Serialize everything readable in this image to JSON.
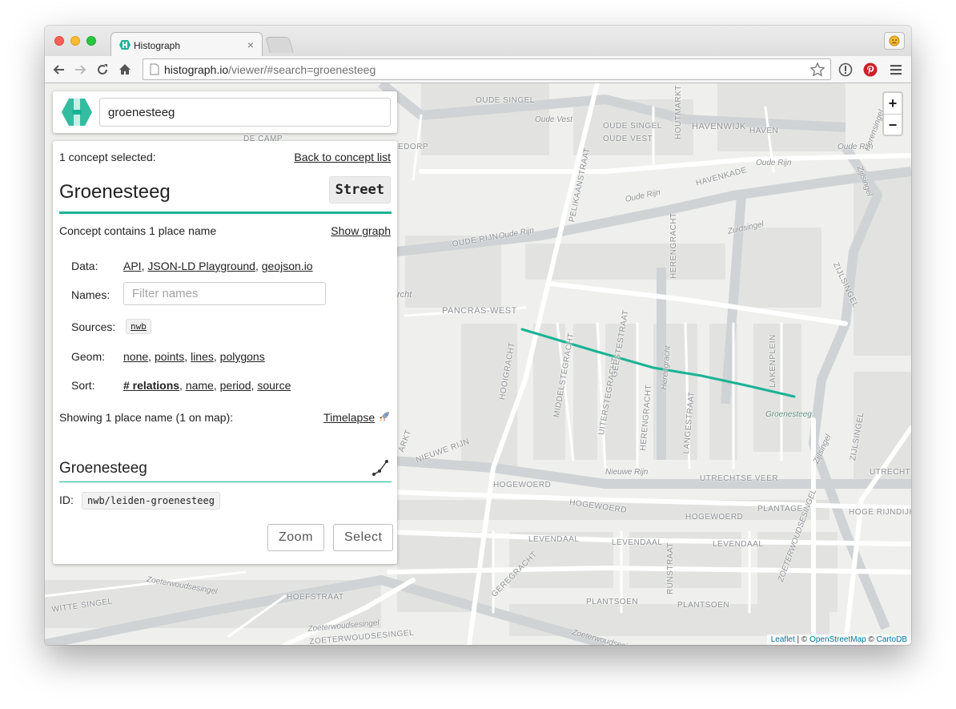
{
  "browser": {
    "tab_title": "Histograph",
    "tab_close": "×",
    "url_host": "histograph.io",
    "url_path": "/viewer/#search=groenesteeg"
  },
  "search": {
    "value": "groenesteeg"
  },
  "panel": {
    "selected_text": "1 concept selected:",
    "back_link": "Back to concept list",
    "concept_name": "Groenesteeg",
    "concept_type": "Street",
    "contains_text": "Concept contains 1 place name",
    "show_graph": "Show graph",
    "data_label": "Data:",
    "data_links": [
      "API",
      "JSON-LD Playground",
      "geojson.io"
    ],
    "names_label": "Names:",
    "names_placeholder": "Filter names",
    "sources_label": "Sources:",
    "sources_value": "nwb",
    "geom_label": "Geom:",
    "geom_links": [
      "none",
      "points",
      "lines",
      "polygons"
    ],
    "sort_label": "Sort:",
    "sort_links": [
      "# relations",
      "name",
      "period",
      "source"
    ],
    "showing_text": "Showing 1 place name (1 on map):",
    "timelapse": "Timelapse",
    "place": {
      "name": "Groenesteeg",
      "id_label": "ID:",
      "id_value": "nwb/leiden-groenesteeg"
    },
    "zoom_button": "Zoom",
    "select_button": "Select"
  },
  "map": {
    "zoom_in": "+",
    "zoom_out": "−",
    "highlight_color": "#1ab394",
    "labels": {
      "oude_singel_1": "OUDE SINGEL",
      "oude_vest": "Oude Vest",
      "oude_singel_2": "OUDE SINGEL",
      "oude_vest_2": "OUDE VEST",
      "havenwijk": "HAVENWIJK",
      "haven": "HAVEN",
      "de_camp": "DE CAMP",
      "edorp": "EDORP",
      "houtmarkt": "HOUTMARKT",
      "pelikaanstraat": "PELIKAANSTRAAT",
      "oude_rijn_1": "Oude Rijn",
      "oude_rijn_2": "Oude Rijn",
      "oude_rijn_3": "OUDE RIJN",
      "oude_rijn_4": "Oude Rijn",
      "havenkade": "HAVENKADE",
      "zuidsingel": "Zuidsingel",
      "herengracht_1": "HERENGRACHT",
      "herensingel": "Herensingel",
      "zijlsingel_1": "Zijlsingel",
      "zijlsingel_2": "ZIJLSINGEL",
      "zijlsingel_3": "Zijlsingel",
      "zijlsingel_4": "ZIJLSINGEL",
      "oude_rijn_5": "Oude Rijn",
      "pancras_west": "PANCRAS-WEST",
      "rcht": "rcht",
      "hooigracht": "HOOIGRACHT",
      "middelstegracht": "MIDDELSTEGRACHT",
      "uiterstegracht": "UITERSTEGRACHT",
      "geestestraat": "GEESTESTRAAT",
      "herengracht_2": "Herengracht",
      "herengracht_3": "HERENGRACHT",
      "langestraat": "LANGESTRAAT",
      "lakenplein": "LAKENPLEIN",
      "groenesteeg": "Groenesteeg",
      "nieuwe_rijn_1": "NIEUWE RIJN",
      "nieuwe_rijn_2": "Nieuwe Rijn",
      "utrechtse_veer": "UTRECHTSE VEER",
      "utrechts": "UTRECHTS",
      "hogewoerd_1": "HOGEWOERD",
      "hogewoerd_2": "HOGEWOERD",
      "hogewoerd_3": "HOGEWOERD",
      "plantage": "PLANTAGE",
      "hoge_rijndijk": "HOGE RIJNDIJK",
      "levendaal_1": "LEVENDAAL",
      "levendaal_2": "LEVENDAAL",
      "levendaal_3": "LEVENDAAL",
      "geregracht": "GEREGRACHT",
      "runstraat": "RUNSTRAAT",
      "zoeterwoudsesingel_1": "Zoeterwoudsesingel",
      "zoeterwoudsesingel_2": "Zoeterwoudsesingel",
      "zoeterwoudsesingel_3": "ZOETERWOUDSESINGEL",
      "zoeterwoudsesingel_4": "Zoeterwoudsesingel",
      "zoeterwoudsesingel_5": "ZOETERWOUDSESINGEL",
      "witte_singel": "WITTE SINGEL",
      "hoefstraat": "HOEFSTRAAT",
      "plantsoen_1": "PLANTSOEN",
      "plantsoen_2": "PLANTSOEN",
      "arkt": "ARKT"
    },
    "attribution": {
      "leaflet": "Leaflet",
      "sep1": " | © ",
      "osm": "OpenStreetMap",
      "sep2": " © ",
      "carto": "CartoDB"
    }
  }
}
